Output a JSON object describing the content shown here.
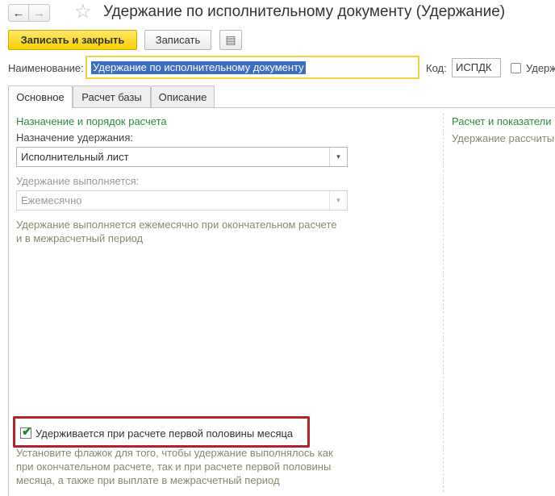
{
  "window": {
    "title": "Удержание по исполнительному документу (Удержание)",
    "back_icon": "←",
    "forward_icon": "→",
    "favorite_icon": "☆"
  },
  "toolbar": {
    "save_close_label": "Записать и закрыть",
    "save_label": "Записать",
    "more_icon": "▤"
  },
  "form": {
    "name_label": "Наименование:",
    "name_value": "Удержание по исполнительному документу",
    "code_label": "Код:",
    "code_value": "ИСПДК",
    "right_checkbox_label": "Удерж"
  },
  "tabs": [
    {
      "label": "Основное",
      "active": true
    },
    {
      "label": "Расчет базы",
      "active": false
    },
    {
      "label": "Описание",
      "active": false
    }
  ],
  "main": {
    "section_title": "Назначение и порядок расчета",
    "purpose_label": "Назначение удержания:",
    "purpose_value": "Исполнительный лист",
    "performed_label": "Удержание выполняется:",
    "performed_value": "Ежемесячно",
    "performed_hint_line1": "Удержание выполняется ежемесячно при окончательном расчете",
    "performed_hint_line2": "и в межрасчетный период",
    "first_half_checkbox_label": "Удерживается при расчете первой половины месяца",
    "first_half_checked": true,
    "first_half_hint_line1": "Установите флажок для того, чтобы удержание выполнялось как",
    "first_half_hint_line2": "при окончательном расчете, так и при расчете первой половины",
    "first_half_hint_line3": "месяца, а также при выплате в межрасчетный период"
  },
  "right_panel": {
    "section_title": "Расчет и показатели",
    "hint": "Удержание рассчиты"
  },
  "colors": {
    "accent_yellow": "#f5d100",
    "section_green": "#2e8b3e",
    "highlight_red": "#b3222a",
    "selection_blue": "#3c6ec2"
  }
}
